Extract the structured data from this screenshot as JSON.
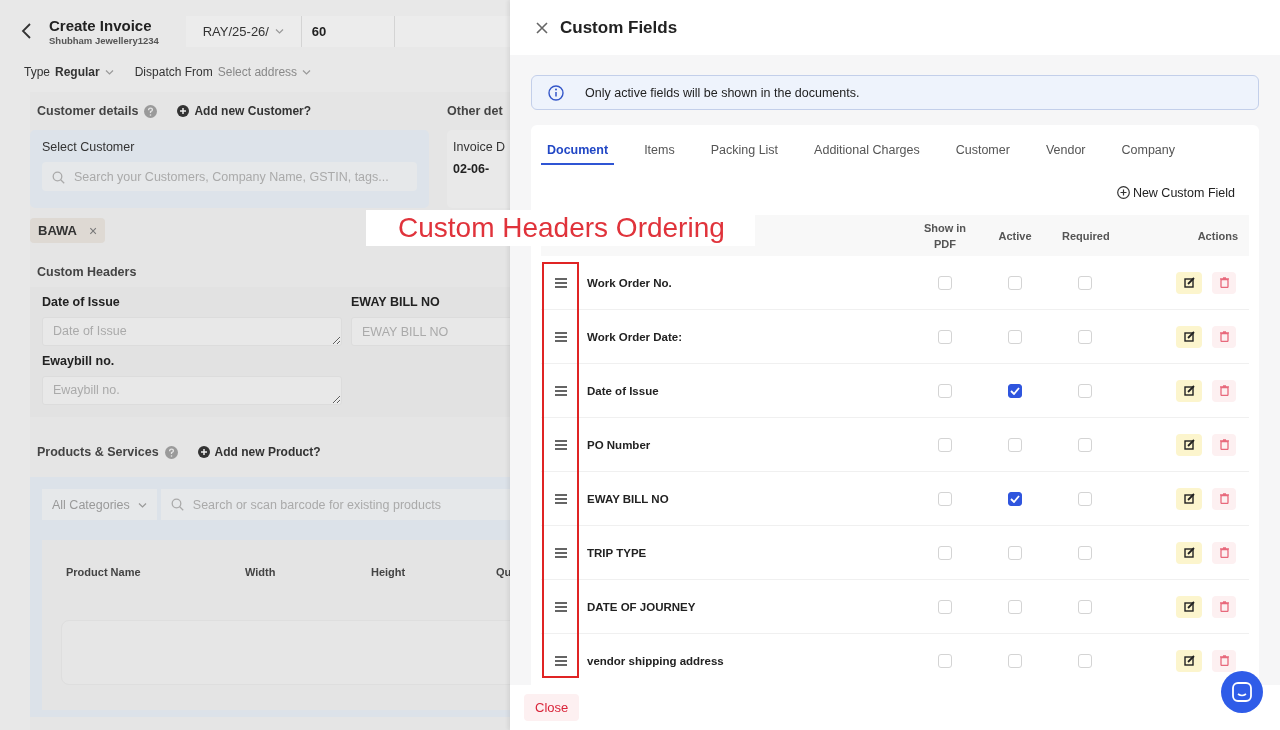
{
  "invoice_page": {
    "title": "Create Invoice",
    "subtitle": "Shubham Jewellery1234",
    "series": "RAY/25-26/",
    "number": "60",
    "type_label": "Type",
    "type_value": "Regular",
    "dispatch_label": "Dispatch From",
    "dispatch_value": "Select address",
    "customer_heading": "Customer details",
    "add_customer": "Add new Customer?",
    "other_heading": "Other det",
    "select_customer_label": "Select Customer",
    "customer_search": {
      "placeholder": "Search your Customers, Company Name, GSTIN, tags..."
    },
    "invoice_date_label": "Invoice D",
    "invoice_date_value": "02-06-",
    "customer_chip": "BAWA",
    "chip_remove": "×",
    "custom_headers_heading": "Custom Headers",
    "custom_headers": [
      {
        "label": "Date of Issue",
        "placeholder": "Date of Issue",
        "kind": "textarea"
      },
      {
        "label": "EWAY BILL NO",
        "placeholder": "EWAY BILL NO",
        "kind": "input"
      },
      {
        "label": "Ewaybill no.",
        "placeholder": "Ewaybill no.",
        "kind": "textarea"
      }
    ],
    "products_heading": "Products & Services",
    "add_product": "Add new Product?",
    "category": "All Categories",
    "product_search": {
      "placeholder": "Search or scan barcode for existing products"
    },
    "product_columns": [
      "Product Name",
      "Width",
      "Height",
      "Qu"
    ]
  },
  "drawer": {
    "title": "Custom Fields",
    "notice": "Only active fields will be shown in the documents.",
    "tabs": [
      {
        "label": "Document",
        "selected": true
      },
      {
        "label": "Items",
        "selected": false
      },
      {
        "label": "Packing List",
        "selected": false
      },
      {
        "label": "Additional Charges",
        "selected": false
      },
      {
        "label": "Customer",
        "selected": false
      },
      {
        "label": "Vendor",
        "selected": false
      },
      {
        "label": "Company",
        "selected": false
      }
    ],
    "new_field": "New Custom Field",
    "columns": [
      "Show in PDF",
      "Active",
      "Required",
      "Actions"
    ],
    "rows": [
      {
        "name": "Work Order No.",
        "show_in_pdf": false,
        "active": false,
        "required": false
      },
      {
        "name": "Work Order Date:",
        "show_in_pdf": false,
        "active": false,
        "required": false
      },
      {
        "name": "Date of Issue",
        "show_in_pdf": false,
        "active": true,
        "required": false
      },
      {
        "name": "PO Number",
        "show_in_pdf": false,
        "active": false,
        "required": false
      },
      {
        "name": "EWAY BILL NO",
        "show_in_pdf": false,
        "active": true,
        "required": false
      },
      {
        "name": "TRIP TYPE",
        "show_in_pdf": false,
        "active": false,
        "required": false
      },
      {
        "name": "DATE OF JOURNEY",
        "show_in_pdf": false,
        "active": false,
        "required": false
      },
      {
        "name": "vendor shipping address",
        "show_in_pdf": false,
        "active": false,
        "required": false
      }
    ],
    "close": "Close"
  },
  "annotation": {
    "label": "Custom Headers Ordering"
  }
}
